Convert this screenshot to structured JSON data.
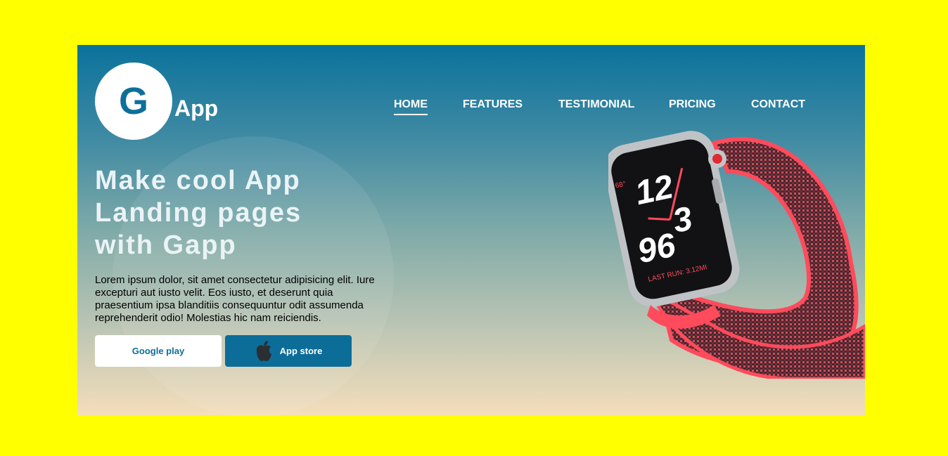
{
  "brand": {
    "logo_letter": "G",
    "name": "App"
  },
  "nav": {
    "items": [
      {
        "label": "HOME",
        "active": true
      },
      {
        "label": "FEATURES",
        "active": false
      },
      {
        "label": "TESTIMONIAL",
        "active": false
      },
      {
        "label": "PRICING",
        "active": false
      },
      {
        "label": "CONTACT",
        "active": false
      }
    ]
  },
  "hero": {
    "headline_lines": [
      "Make cool App",
      "Landing pages",
      "with Gapp"
    ],
    "description": "Lorem ipsum dolor, sit amet consectetur adipisicing elit. Iure excepturi aut iusto velit. Eos iusto, et deserunt quia praesentium ipsa blanditiis consequuntur odit assumenda reprehenderit odio! Molestias hic nam reiciendis.",
    "google_button": "Google play",
    "apple_button": "App store"
  },
  "watch": {
    "temp": "68°",
    "hour": "12",
    "minute_top": "3",
    "bottom_digits": "96",
    "status": "LAST RUN: 3.12MI"
  },
  "colors": {
    "page_background": "#ffff00",
    "gradient_top": "#0b729c",
    "gradient_bottom": "#f5debb",
    "accent": "#0b6d98",
    "band_red": "#ff4b5c"
  },
  "icons": [
    "apple-icon",
    "watch-image"
  ]
}
